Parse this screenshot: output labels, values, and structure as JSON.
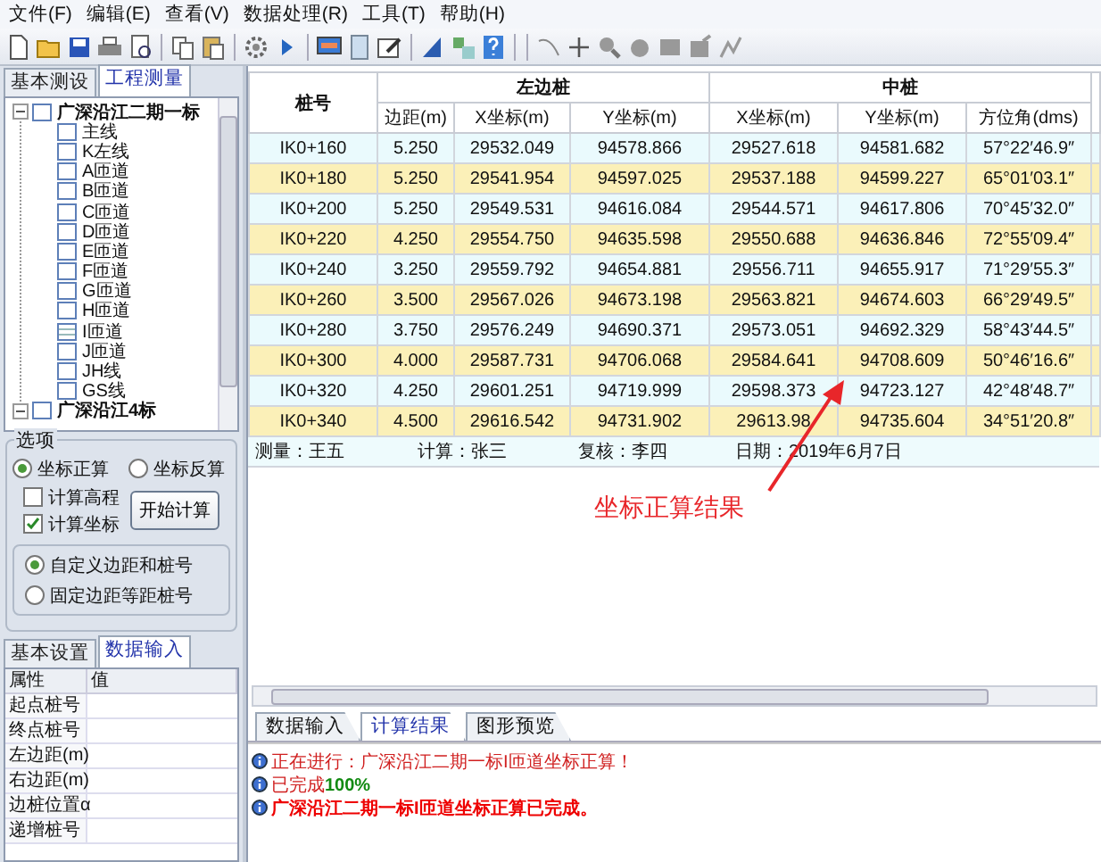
{
  "menu": [
    "文件(F)",
    "编辑(E)",
    "查看(V)",
    "数据处理(R)",
    "工具(T)",
    "帮助(H)"
  ],
  "left_tabs": [
    {
      "label": "基本测设",
      "selected": false
    },
    {
      "label": "工程测量",
      "selected": true
    }
  ],
  "tree": [
    {
      "label": "广深沿江二期一标",
      "expanded": true,
      "checked": false,
      "children": [
        {
          "label": "主线",
          "selected": false
        },
        {
          "label": "K左线",
          "selected": false
        },
        {
          "label": "A匝道",
          "selected": false
        },
        {
          "label": "B匝道",
          "selected": false
        },
        {
          "label": "C匝道",
          "selected": false
        },
        {
          "label": "D匝道",
          "selected": false
        },
        {
          "label": "E匝道",
          "selected": false
        },
        {
          "label": "F匝道",
          "selected": false
        },
        {
          "label": "G匝道",
          "selected": false
        },
        {
          "label": "H匝道",
          "selected": false
        },
        {
          "label": "I匝道",
          "selected": true
        },
        {
          "label": "J匝道",
          "selected": false
        },
        {
          "label": "JH线",
          "selected": false
        },
        {
          "label": "GS线",
          "selected": false
        }
      ]
    },
    {
      "label": "广深沿江4标",
      "expanded": true,
      "checked": false
    }
  ],
  "options": {
    "title": "选项",
    "modes": [
      {
        "label": "坐标正算",
        "selected": true
      },
      {
        "label": "坐标反算",
        "selected": false
      }
    ],
    "checks": [
      {
        "label": "计算高程",
        "checked": false
      },
      {
        "label": "计算坐标",
        "checked": true
      }
    ],
    "start_button": "开始计算",
    "stake_modes": [
      {
        "label": "自定义边距和桩号",
        "selected": true
      },
      {
        "label": "固定边距等距桩号",
        "selected": false
      }
    ]
  },
  "lower_tabs": [
    {
      "label": "基本设置",
      "selected": false
    },
    {
      "label": "数据输入",
      "selected": true
    }
  ],
  "properties": {
    "columns": [
      "属性",
      "值"
    ],
    "rows": [
      "起点桩号",
      "终点桩号",
      "左边距(m)",
      "右边距(m)",
      "边桩位置α",
      "递增桩号"
    ]
  },
  "table": {
    "stake_header": "桩号",
    "groups": [
      {
        "label": "左边桩",
        "columns": [
          "边距(m)",
          "X坐标(m)",
          "Y坐标(m)"
        ]
      },
      {
        "label": "中桩",
        "columns": [
          "X坐标(m)",
          "Y坐标(m)",
          "方位角(dms)"
        ]
      }
    ],
    "rows": [
      [
        "IK0+160",
        "5.250",
        "29532.049",
        "94578.866",
        "29527.618",
        "94581.682",
        "57°22′46.9″"
      ],
      [
        "IK0+180",
        "5.250",
        "29541.954",
        "94597.025",
        "29537.188",
        "94599.227",
        "65°01′03.1″"
      ],
      [
        "IK0+200",
        "5.250",
        "29549.531",
        "94616.084",
        "29544.571",
        "94617.806",
        "70°45′32.0″"
      ],
      [
        "IK0+220",
        "4.250",
        "29554.750",
        "94635.598",
        "29550.688",
        "94636.846",
        "72°55′09.4″"
      ],
      [
        "IK0+240",
        "3.250",
        "29559.792",
        "94654.881",
        "29556.711",
        "94655.917",
        "71°29′55.3″"
      ],
      [
        "IK0+260",
        "3.500",
        "29567.026",
        "94673.198",
        "29563.821",
        "94674.603",
        "66°29′49.5″"
      ],
      [
        "IK0+280",
        "3.750",
        "29576.249",
        "94690.371",
        "29573.051",
        "94692.329",
        "58°43′44.5″"
      ],
      [
        "IK0+300",
        "4.000",
        "29587.731",
        "94706.068",
        "29584.641",
        "94708.609",
        "50°46′16.6″"
      ],
      [
        "IK0+320",
        "4.250",
        "29601.251",
        "94719.999",
        "29598.373",
        "94723.127",
        "42°48′48.7″"
      ],
      [
        "IK0+340",
        "4.500",
        "29616.542",
        "94731.902",
        "29613.98",
        "94735.604",
        "34°51′20.8″"
      ]
    ],
    "footer": [
      "测量：王五",
      "计算：张三",
      "复核：李四",
      "日期：2019年6月7日"
    ]
  },
  "annotation": "坐标正算结果",
  "bottom_tabs": [
    {
      "label": "数据输入",
      "selected": false
    },
    {
      "label": "计算结果",
      "selected": true
    },
    {
      "label": "图形预览",
      "selected": false
    }
  ],
  "log": [
    {
      "kind": "progress",
      "text": "正在进行：广深沿江二期一标I匝道坐标正算！"
    },
    {
      "kind": "percent",
      "text": "已完成",
      "value": "100%"
    },
    {
      "kind": "done",
      "text": "广深沿江二期一标I匝道坐标正算已完成。"
    }
  ]
}
